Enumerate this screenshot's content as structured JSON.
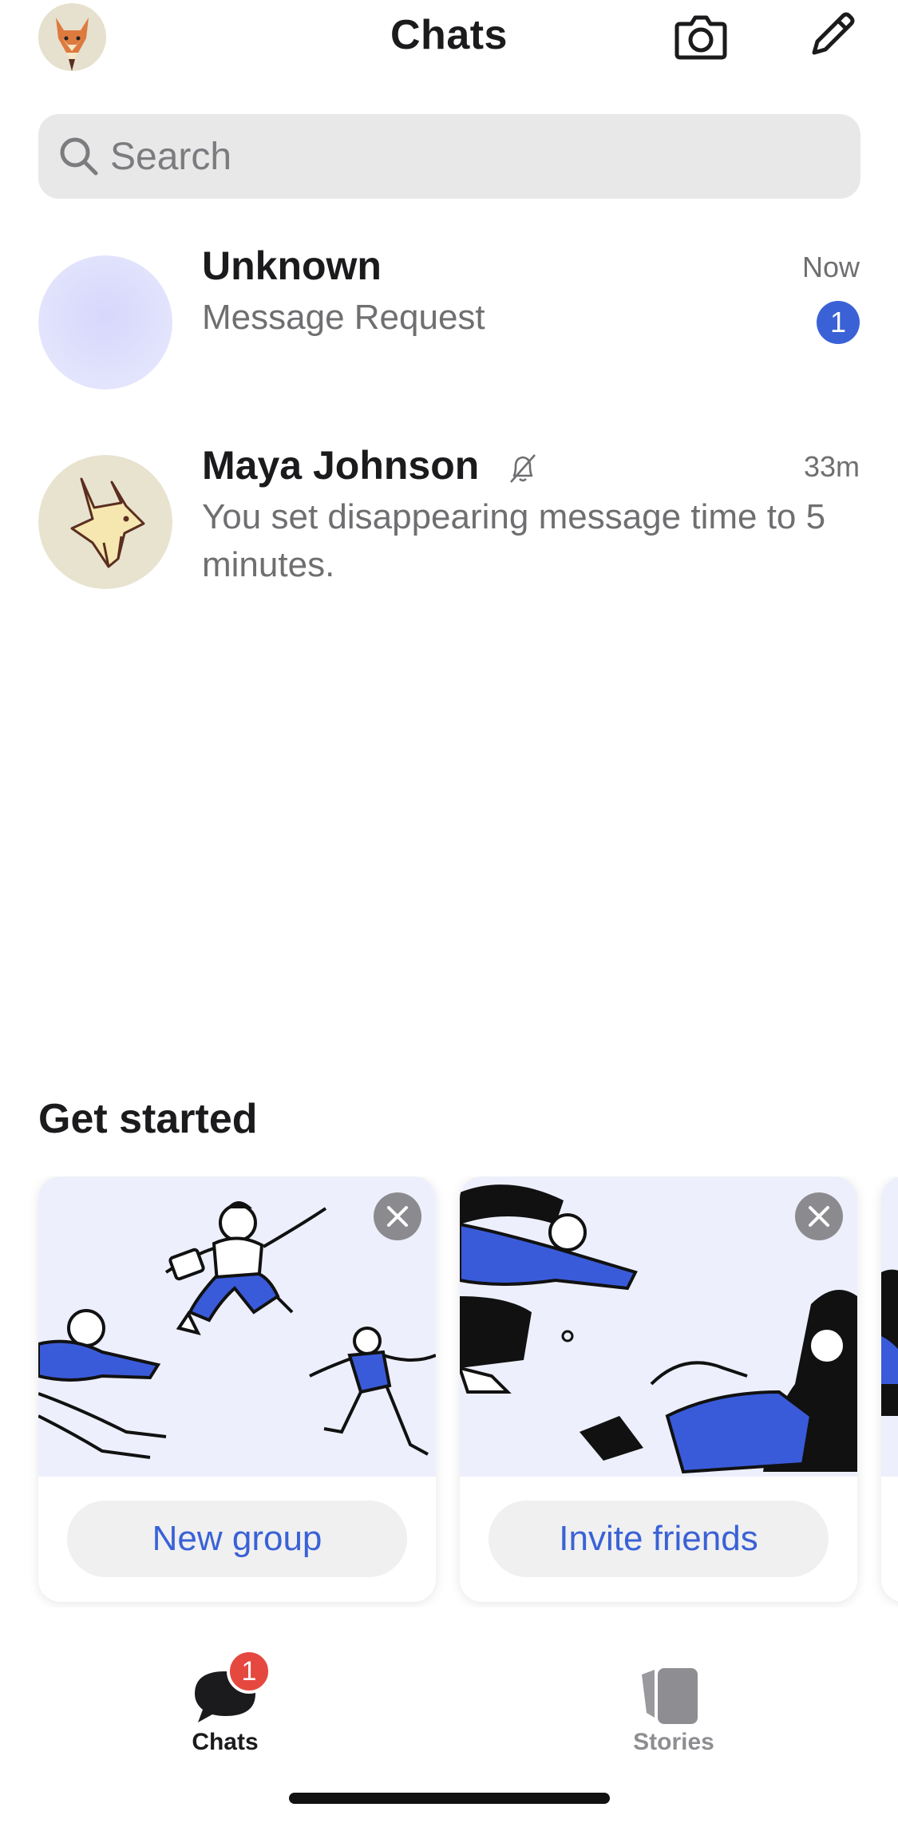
{
  "header": {
    "title": "Chats",
    "profile_icon": "fox-avatar",
    "camera_icon": "camera-icon",
    "compose_icon": "pencil-icon"
  },
  "search": {
    "placeholder": "Search"
  },
  "chats": [
    {
      "name": "Unknown",
      "snippet": "Message Request",
      "time": "Now",
      "unread": "1",
      "avatar": "blank-avatar"
    },
    {
      "name": "Maya Johnson",
      "snippet": "You set disappearing message time to 5 minutes.",
      "time": "33m",
      "muted": true,
      "avatar": "fox-avatar"
    }
  ],
  "get_started": {
    "title": "Get started",
    "cards": [
      {
        "label": "New group",
        "illustration": "people-jumping"
      },
      {
        "label": "Invite friends",
        "illustration": "people-reaching"
      }
    ]
  },
  "tabbar": {
    "tabs": [
      {
        "label": "Chats",
        "badge": "1",
        "active": true,
        "icon": "chat-bubble-icon"
      },
      {
        "label": "Stories",
        "active": false,
        "icon": "stories-icon"
      }
    ]
  },
  "colors": {
    "accent": "#3a62d6",
    "badge_red": "#e5483f",
    "illustration_bg": "#edeffc",
    "text_secondary": "#6f6f72"
  }
}
